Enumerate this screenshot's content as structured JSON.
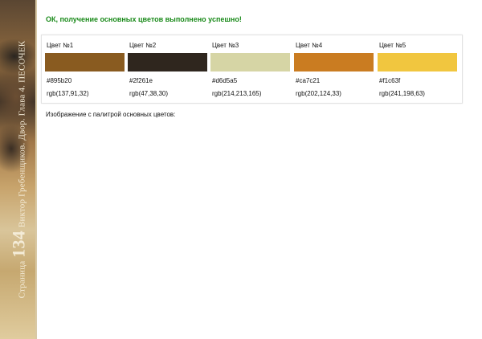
{
  "sidebar": {
    "page_label": "Страница",
    "page_number": "134",
    "book_caption": "Виктор Гребенщиков. Двор. Глава 4. ПЕСОЧЕК"
  },
  "status": {
    "message": "ОК, получение основных цветов выполнено успешно!",
    "color": "#1a8a1a"
  },
  "palette": {
    "colors": [
      {
        "title": "Цвет №1",
        "hex": "#895b20",
        "rgb": "rgb(137,91,32)"
      },
      {
        "title": "Цвет №2",
        "hex": "#2f261e",
        "rgb": "rgb(47,38,30)"
      },
      {
        "title": "Цвет №3",
        "hex": "#d6d5a5",
        "rgb": "rgb(214,213,165)"
      },
      {
        "title": "Цвет №4",
        "hex": "#ca7c21",
        "rgb": "rgb(202,124,33)"
      },
      {
        "title": "Цвет №5",
        "hex": "#f1c63f",
        "rgb": "rgb(241,198,63)"
      }
    ]
  },
  "caption": "Изображение с палитрой основных цветов:"
}
